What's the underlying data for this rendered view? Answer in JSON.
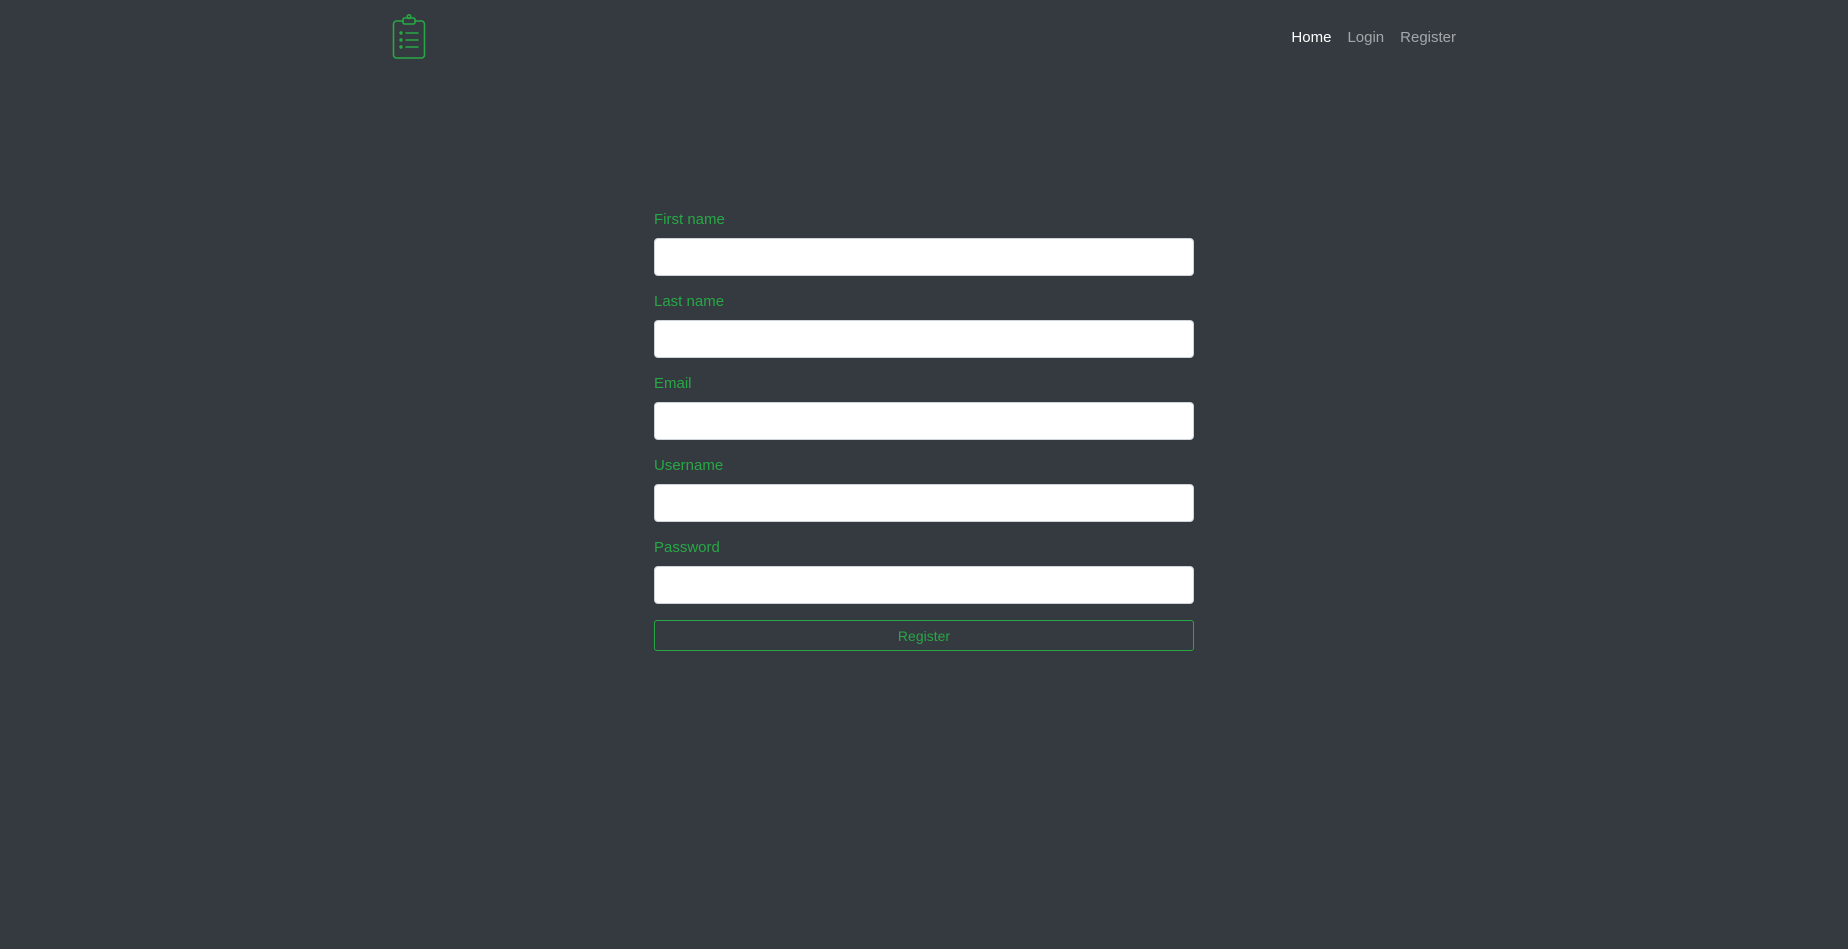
{
  "nav": {
    "brand_icon": "clipboard-list-icon",
    "brand_color": "#28a745",
    "links": [
      {
        "label": "Home",
        "active": true
      },
      {
        "label": "Login",
        "active": false
      },
      {
        "label": "Register",
        "active": false
      }
    ]
  },
  "form": {
    "fields": [
      {
        "label": "First name",
        "value": "",
        "type": "text"
      },
      {
        "label": "Last name",
        "value": "",
        "type": "text"
      },
      {
        "label": "Email",
        "value": "",
        "type": "email"
      },
      {
        "label": "Username",
        "value": "",
        "type": "text"
      },
      {
        "label": "Password",
        "value": "",
        "type": "password"
      }
    ],
    "submit_label": "Register"
  },
  "colors": {
    "background": "#343a40",
    "accent": "#28a745",
    "nav_active": "#ffffff",
    "nav_inactive": "rgba(255,255,255,0.55)"
  }
}
